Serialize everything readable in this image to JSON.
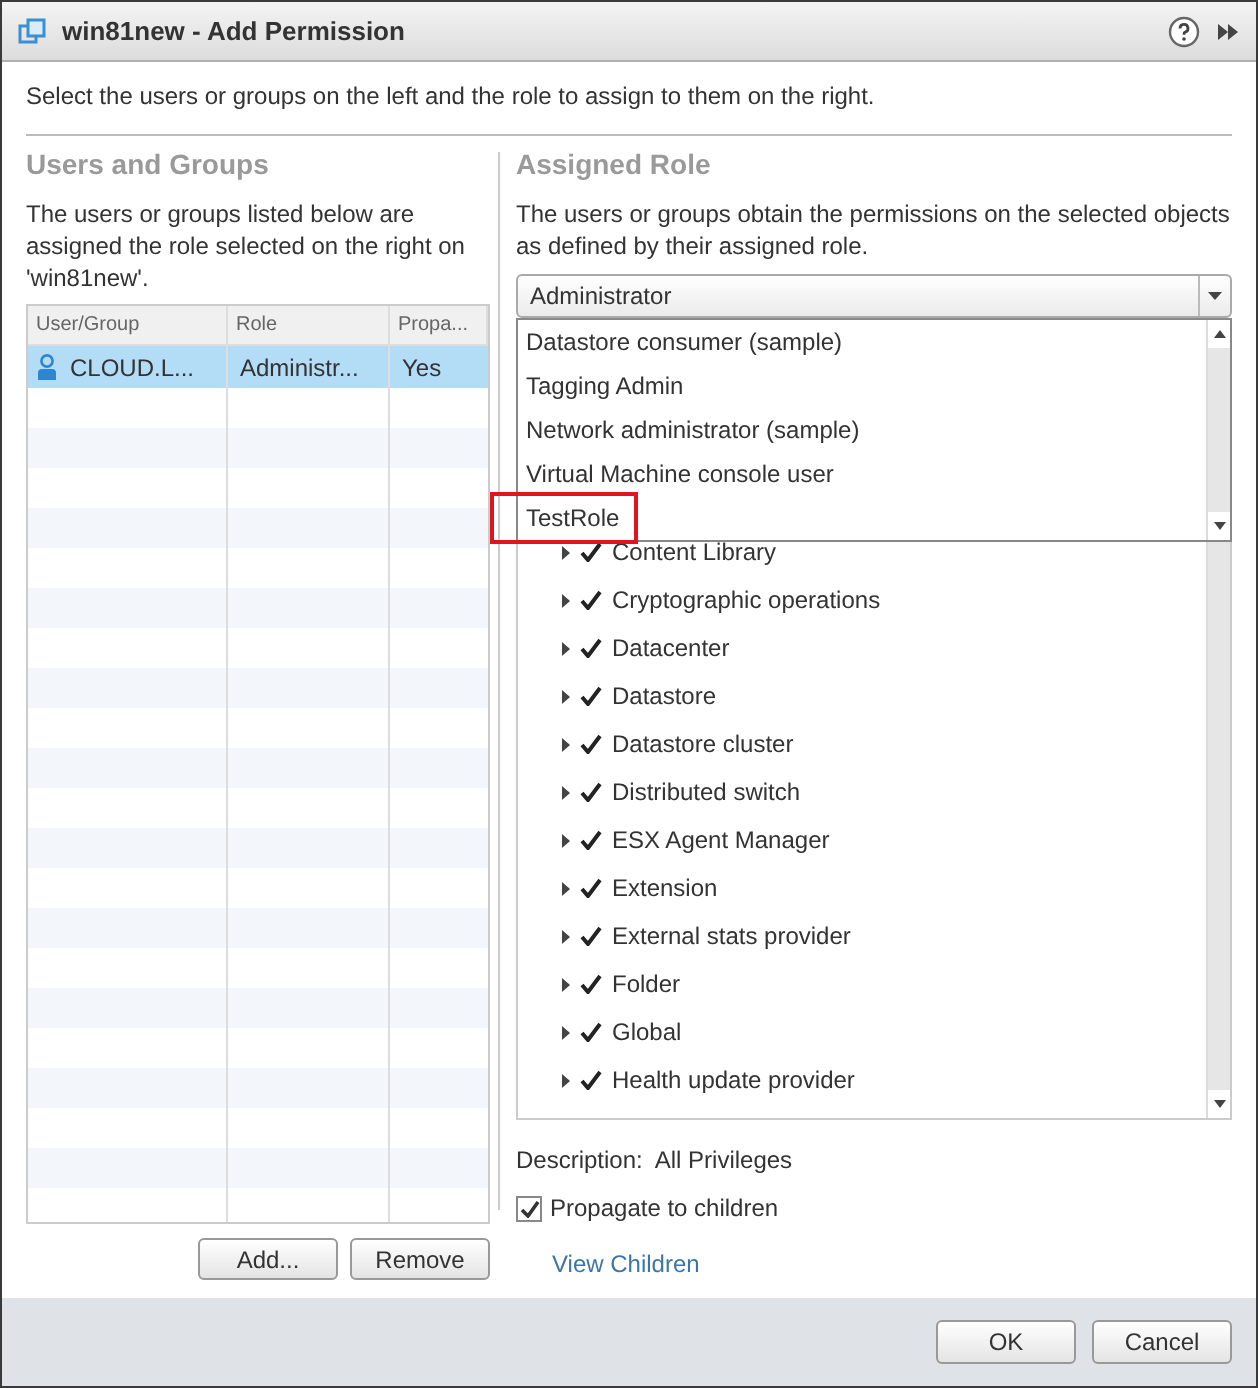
{
  "window": {
    "title": "win81new - Add Permission"
  },
  "instruction": "Select the users or groups on the left and the role to assign to them on the right.",
  "users_panel": {
    "heading": "Users and Groups",
    "description": "The users or groups listed below are assigned the role selected on the right on 'win81new'.",
    "columns": [
      "User/Group",
      "Role",
      "Propa..."
    ],
    "rows": [
      {
        "user": "CLOUD.L...",
        "role": "Administr...",
        "propagate": "Yes",
        "selected": true
      }
    ],
    "buttons": [
      "Add...",
      "Remove"
    ]
  },
  "role_panel": {
    "heading": "Assigned Role",
    "description": "The users or groups obtain the permissions on the selected objects as defined by their assigned role.",
    "role_select": {
      "value": "Administrator",
      "expanded": true,
      "options": [
        {
          "label": "Datastore consumer (sample)",
          "highlighted": false
        },
        {
          "label": "Tagging Admin",
          "highlighted": false
        },
        {
          "label": "Network administrator (sample)",
          "highlighted": false
        },
        {
          "label": "Virtual Machine console user",
          "highlighted": false
        },
        {
          "label": "TestRole",
          "highlighted": true
        }
      ]
    },
    "privileges": [
      {
        "label": "Content Library",
        "checked": true
      },
      {
        "label": "Cryptographic operations",
        "checked": true
      },
      {
        "label": "Datacenter",
        "checked": true
      },
      {
        "label": "Datastore",
        "checked": true
      },
      {
        "label": "Datastore cluster",
        "checked": true
      },
      {
        "label": "Distributed switch",
        "checked": true
      },
      {
        "label": "ESX Agent Manager",
        "checked": true
      },
      {
        "label": "Extension",
        "checked": true
      },
      {
        "label": "External stats provider",
        "checked": true
      },
      {
        "label": "Folder",
        "checked": true
      },
      {
        "label": "Global",
        "checked": true
      },
      {
        "label": "Health update provider",
        "checked": true
      }
    ],
    "description_label": "Description:",
    "description_value": "All Privileges",
    "propagate": {
      "label": "Propagate to children",
      "checked": true
    },
    "view_children": "View Children"
  },
  "footer_buttons": [
    "OK",
    "Cancel"
  ]
}
